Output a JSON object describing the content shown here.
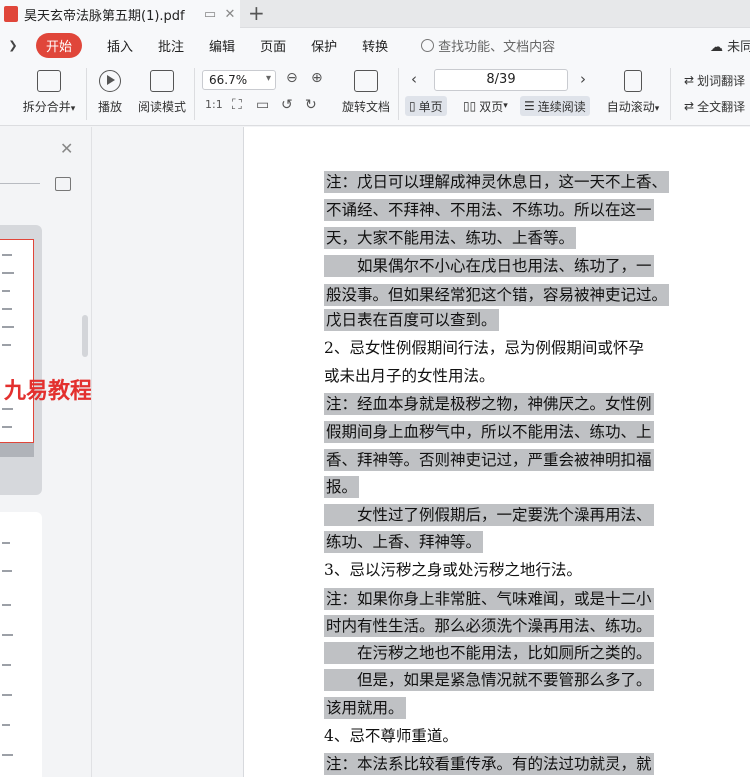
{
  "titlebar": {
    "tab_title": "昊天玄帝法脉第五期(1).pdf",
    "new_tab": "+"
  },
  "menubar": {
    "items": [
      "开始",
      "插入",
      "批注",
      "编辑",
      "页面",
      "保护",
      "转换"
    ],
    "search_placeholder": "查找功能、文档内容",
    "right_label": "未同"
  },
  "toolbar": {
    "split_merge": "拆分合并",
    "play": "播放",
    "read_mode": "阅读模式",
    "zoom": "66.7%",
    "rotate": "旋转文档",
    "page_indicator": "8/39",
    "single_page": "单页",
    "double_page": "双页",
    "continuous": "连续阅读",
    "auto_scroll": "自动滚动",
    "word_translate": "划词翻译",
    "full_translate": "全文翻译"
  },
  "sidebar": {
    "watermark": "九易教程"
  },
  "document": {
    "lines": [
      {
        "text": "注：戊日可以理解成神灵休息日，这一天不上香、",
        "hl": true
      },
      {
        "text": "不诵经、不拜神、不用法、不练功。所以在这一",
        "hl": true
      },
      {
        "text": "天，大家不能用法、练功、上香等。",
        "hl": true
      },
      {
        "text": "　　如果偶尔不小心在戊日也用法、练功了，一",
        "hl": true
      },
      {
        "text": "般没事。但如果经常犯这个错，容易被神吏记过。",
        "hl": true
      },
      {
        "text": "戊日表在百度可以查到。",
        "hl": true
      },
      {
        "text": "2、忌女性例假期间行法，忌为例假期间或怀孕",
        "hl": false
      },
      {
        "text": "或未出月子的女性用法。",
        "hl": false
      },
      {
        "text": "注：经血本身就是极秽之物，神佛厌之。女性例",
        "hl": true
      },
      {
        "text": "假期间身上血秽气中，所以不能用法、练功、上",
        "hl": true
      },
      {
        "text": "香、拜神等。否则神吏记过，严重会被神明扣福",
        "hl": true
      },
      {
        "text": "报。",
        "hl": true
      },
      {
        "text": "　　女性过了例假期后，一定要洗个澡再用法、",
        "hl": true
      },
      {
        "text": "练功、上香、拜神等。",
        "hl": true
      },
      {
        "text": "3、忌以污秽之身或处污秽之地行法。",
        "hl": false
      },
      {
        "text": "注：如果你身上非常脏、气味难闻，或是十二小",
        "hl": true
      },
      {
        "text": "时内有性生活。那么必须洗个澡再用法、练功。",
        "hl": true
      },
      {
        "text": "　　在污秽之地也不能用法，比如厕所之类的。",
        "hl": true
      },
      {
        "text": "　　但是，如果是紧急情况就不要管那么多了。",
        "hl": true
      },
      {
        "text": "该用就用。",
        "hl": true
      },
      {
        "text": "4、忌不尊师重道。",
        "hl": false
      },
      {
        "text": "注：本法系比较看重传承。有的法过功就灵，就",
        "hl": true
      }
    ]
  }
}
